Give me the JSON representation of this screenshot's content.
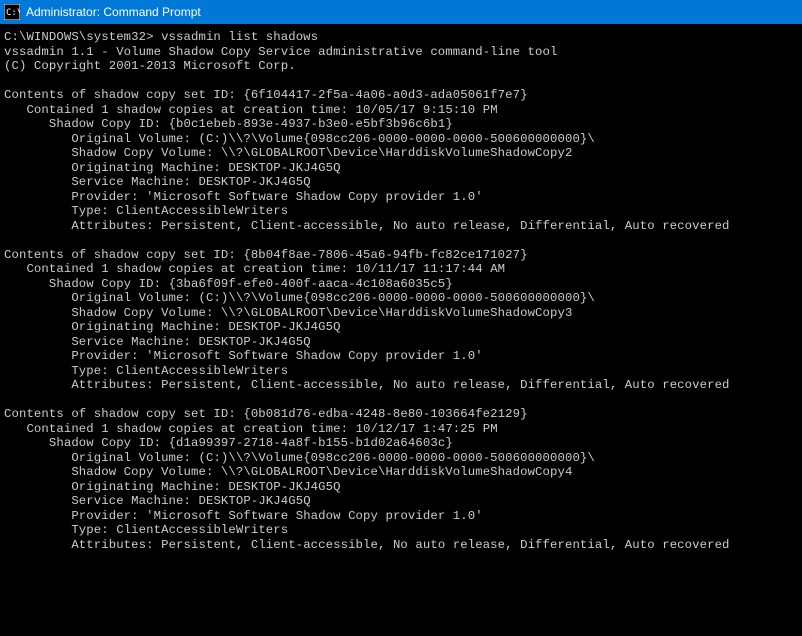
{
  "title": "Administrator: Command Prompt",
  "prompt": "C:\\WINDOWS\\system32>",
  "command": "vssadmin list shadows",
  "header_line1": "vssadmin 1.1 - Volume Shadow Copy Service administrative command-line tool",
  "header_line2": "(C) Copyright 2001-2013 Microsoft Corp.",
  "labels": {
    "set_id": "Contents of shadow copy set ID:",
    "contained": "Contained 1 shadow copies at creation time:",
    "shadow_id": "Shadow Copy ID:",
    "orig_vol": "Original Volume:",
    "copy_vol": "Shadow Copy Volume:",
    "orig_mach": "Originating Machine:",
    "svc_mach": "Service Machine:",
    "provider": "Provider:",
    "type": "Type:",
    "attrs": "Attributes:"
  },
  "common": {
    "orig_vol": "(C:)\\\\?\\Volume{098cc206-0000-0000-0000-500600000000}\\",
    "machine": "DESKTOP-JKJ4G5Q",
    "provider": "'Microsoft Software Shadow Copy provider 1.0'",
    "type": "ClientAccessibleWriters",
    "attrs": "Persistent, Client-accessible, No auto release, Differential, Auto recovered"
  },
  "sets": [
    {
      "set_id": "{6f104417-2f5a-4a06-a0d3-ada05061f7e7}",
      "created": "10/05/17 9:15:10 PM",
      "shadow_id": "{b0c1ebeb-893e-4937-b3e0-e5bf3b96c6b1}",
      "copy_vol": "\\\\?\\GLOBALROOT\\Device\\HarddiskVolumeShadowCopy2"
    },
    {
      "set_id": "{8b04f8ae-7806-45a6-94fb-fc82ce171027}",
      "created": "10/11/17 11:17:44 AM",
      "shadow_id": "{3ba6f09f-efe0-400f-aaca-4c108a6035c5}",
      "copy_vol": "\\\\?\\GLOBALROOT\\Device\\HarddiskVolumeShadowCopy3"
    },
    {
      "set_id": "{0b081d76-edba-4248-8e80-103664fe2129}",
      "created": "10/12/17 1:47:25 PM",
      "shadow_id": "{d1a99397-2718-4a8f-b155-b1d02a64603c}",
      "copy_vol": "\\\\?\\GLOBALROOT\\Device\\HarddiskVolumeShadowCopy4"
    }
  ]
}
